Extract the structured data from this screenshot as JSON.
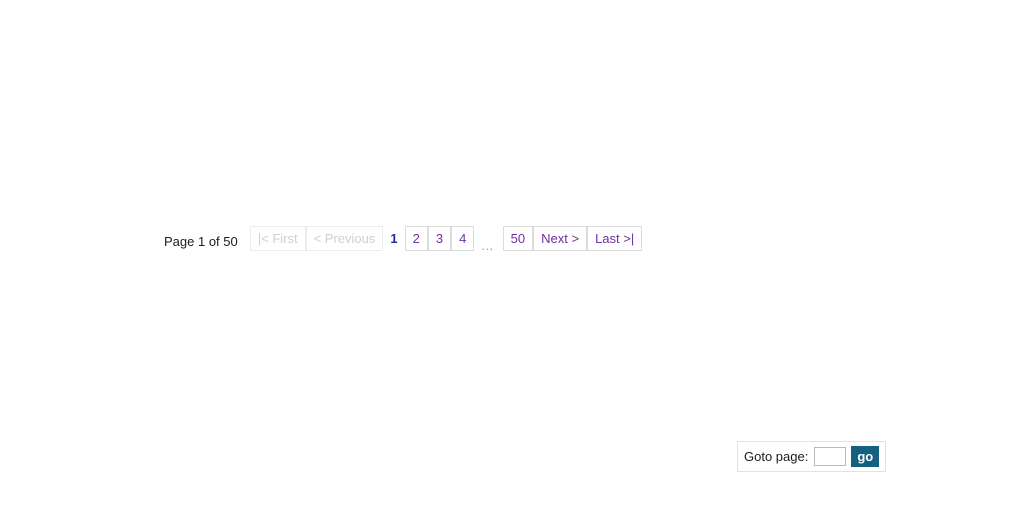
{
  "pagination": {
    "status_text": "Page 1 of 50",
    "current_page": 1,
    "total_pages": 50,
    "ellipsis": "...",
    "colors": {
      "link": "#7030a0",
      "current": "#1f2f8f",
      "disabled": "#cfcfcf",
      "border": "#dcdcdc",
      "go_button_bg": "#14607f",
      "go_button_text": "#ffffff"
    },
    "controls": [
      {
        "key": "first",
        "label": "|< First",
        "state": "disabled"
      },
      {
        "key": "previous",
        "label": "< Previous",
        "state": "disabled"
      },
      {
        "key": "page-1",
        "label": "1",
        "state": "current"
      },
      {
        "key": "page-2",
        "label": "2",
        "state": "link"
      },
      {
        "key": "page-3",
        "label": "3",
        "state": "link"
      },
      {
        "key": "page-4",
        "label": "4",
        "state": "link"
      },
      {
        "key": "gap",
        "label": "...",
        "state": "ellipsis"
      },
      {
        "key": "page-50",
        "label": "50",
        "state": "link"
      },
      {
        "key": "next",
        "label": "Next >",
        "state": "link"
      },
      {
        "key": "last",
        "label": "Last >|",
        "state": "link"
      }
    ]
  },
  "goto": {
    "label": "Goto page:",
    "input_value": "",
    "input_placeholder": "",
    "button_label": "go"
  }
}
